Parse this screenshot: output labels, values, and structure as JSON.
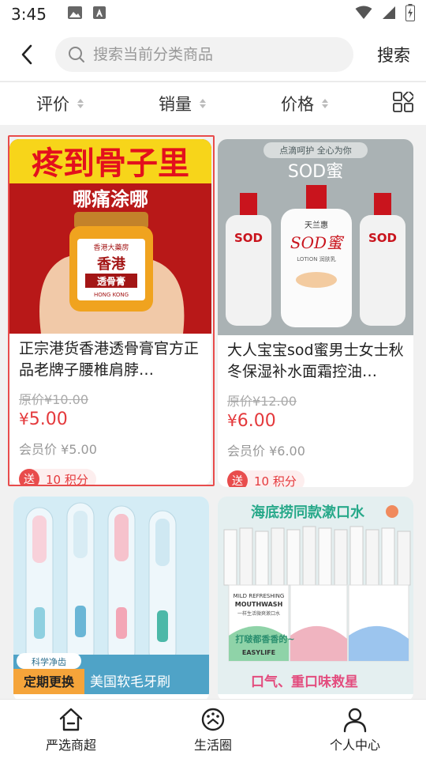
{
  "status_bar": {
    "time": "3:45"
  },
  "header": {
    "search_placeholder": "搜索当前分类商品",
    "search_button": "搜索"
  },
  "sort_bar": {
    "items": [
      {
        "label": "评价"
      },
      {
        "label": "销量"
      },
      {
        "label": "价格"
      }
    ]
  },
  "products": [
    {
      "title": "正宗港货香港透骨膏官方正品老牌子腰椎肩脖…",
      "original_price_label": "原价",
      "original_price": "¥10.00",
      "price_symbol": "¥",
      "price": "5.00",
      "member_price": "会员价 ¥5.00",
      "points_badge": "送",
      "points": "10 积分",
      "image": {
        "headline": "疼到骨子里",
        "subline": "哪痛涂哪",
        "jar_label_top": "香港大藥房",
        "jar_label_main": "香港",
        "jar_label_sub": "透骨膏",
        "jar_label_bottom": "HONG KONG"
      }
    },
    {
      "title": "大人宝宝sod蜜男士女士秋冬保湿补水面霜控油…",
      "original_price_label": "原价",
      "original_price": "¥12.00",
      "price_symbol": "¥",
      "price": "6.00",
      "member_price": "会员价 ¥6.00",
      "points_badge": "送",
      "points": "10 积分",
      "image": {
        "pill": "点滴呵护 全心为你",
        "headline": "SOD蜜",
        "bottle_brand": "天兰惠",
        "bottle_name": "SOD蜜",
        "bottle_sub": "LOTION 润肤乳"
      }
    },
    {
      "image": {
        "tag_top": "科学净齿",
        "tag_main": "定期更换",
        "caption": "美国软毛牙刷"
      }
    },
    {
      "image": {
        "headline": "海底捞同款漱口水",
        "box_en_1": "MILD REFRESHING",
        "box_en_2": "MOUTHWASH",
        "box_cn": "一样生活微爽漱口水",
        "box_brand": "EASYLIFE",
        "callout": "打啵都香香的~",
        "slogan": "口气、重口味救星"
      }
    }
  ],
  "tabbar": {
    "items": [
      {
        "label": "严选商超",
        "icon": "home-icon"
      },
      {
        "label": "生活圈",
        "icon": "life-circle-icon"
      },
      {
        "label": "个人中心",
        "icon": "user-icon"
      }
    ]
  },
  "colors": {
    "price_red": "#e4393c",
    "selected_border": "#e84c4c",
    "background": "#f1f1f1"
  }
}
